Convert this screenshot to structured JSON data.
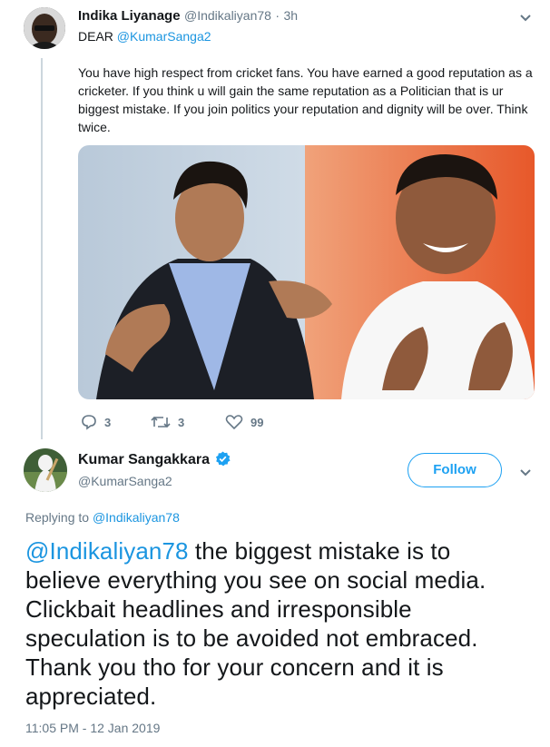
{
  "tweet1": {
    "author_name": "Indika Liyanage",
    "author_handle": "@Indikaliyan78",
    "separator": "·",
    "time": "3h",
    "dear": "DEAR",
    "mention": "@KumarSanga2",
    "text": "You have high respect from cricket fans. You have earned a good reputation as a cricketer. If you think u will gain the same reputation as a Politician that is ur biggest mistake. If you join politics your reputation and dignity will be over. Think twice.",
    "replies": "3",
    "retweets": "3",
    "likes": "99"
  },
  "tweet2": {
    "author_name": "Kumar Sangakkara",
    "author_handle": "@KumarSanga2",
    "follow_label": "Follow",
    "replying_to_label": "Replying to",
    "replying_to_handle": "@Indikaliyan78",
    "mention": "@Indikaliyan78",
    "text": " the biggest mistake is to believe everything you see on social media. Clickbait headlines and irresponsible speculation is to be avoided not embraced. Thank you tho for your concern and it is appreciated.",
    "timestamp": "11:05 PM - 12 Jan 2019"
  },
  "colors": {
    "link": "#1b95e0",
    "follow": "#1da1f2",
    "verified": "#1da1f2",
    "muted": "#657786"
  },
  "icons": [
    "reply-icon",
    "retweet-icon",
    "like-icon",
    "verified-icon",
    "chevron-down-icon"
  ]
}
